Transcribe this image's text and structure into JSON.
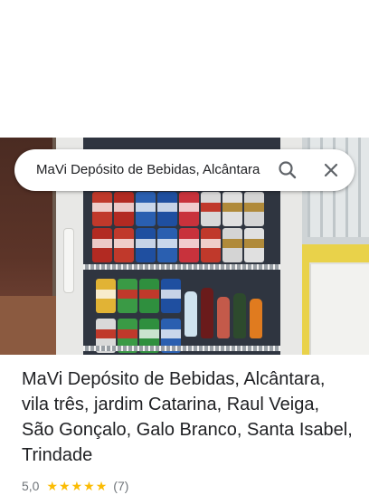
{
  "search": {
    "query": "MaVi Depósito de Bebidas, Alcântara",
    "search_icon": "search-icon",
    "close_icon": "close-icon"
  },
  "place": {
    "name": "MaVi Depósito de Bebidas, Alcântara, vila três, jardim Catarina, Raul Veiga, São Gonçalo, Galo Branco, Santa Isabel, Trindade",
    "rating": "5,0",
    "stars": 5,
    "review_count": "(7)"
  },
  "colors": {
    "star": "#fbbc04",
    "text_primary": "#202124",
    "text_secondary": "#70757a"
  }
}
